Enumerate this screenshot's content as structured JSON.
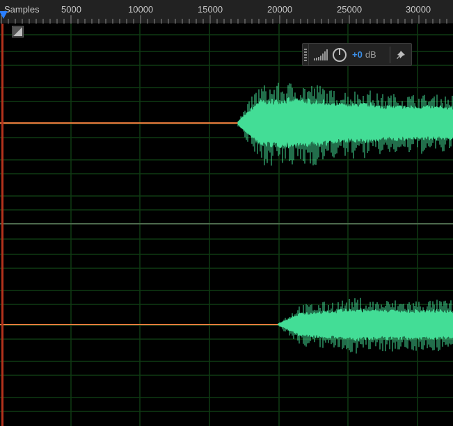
{
  "ruler": {
    "units_label": "Samples",
    "tick_labels": [
      "5000",
      "10000",
      "15000",
      "20000",
      "25000",
      "30000"
    ]
  },
  "hud": {
    "gain_value": "+0",
    "gain_unit": "dB",
    "meter_icon": "volume-meter-icon",
    "knob_icon": "gain-knob-icon",
    "pin_icon": "pin-icon"
  },
  "colors": {
    "waveform": "#43dd96",
    "playhead": "#b3321c",
    "grid": "#0f3a12",
    "silence_line": "#e8793c",
    "hud_value": "#3b8fe8",
    "playhead_marker": "#2a7fff"
  }
}
